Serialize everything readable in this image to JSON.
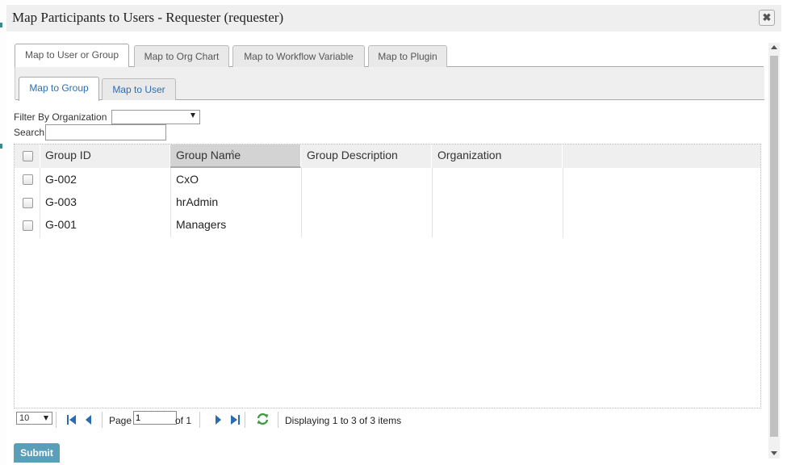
{
  "dialog": {
    "title": "Map Participants to Users - Requester (requester)",
    "close_symbol": "✖"
  },
  "outer_tabs": [
    {
      "label": "Map to User or Group"
    },
    {
      "label": "Map to Org Chart"
    },
    {
      "label": "Map to Workflow Variable"
    },
    {
      "label": "Map to Plugin"
    }
  ],
  "inner_tabs": [
    {
      "label": "Map to Group"
    },
    {
      "label": "Map to User"
    }
  ],
  "filters": {
    "organization_label": "Filter By Organization",
    "organization_value": "",
    "search_label": "Search",
    "search_value": ""
  },
  "grid": {
    "columns": [
      "Group ID",
      "Group Name",
      "Group Description",
      "Organization"
    ],
    "sorted_column": "Group Name",
    "rows": [
      {
        "id": "G-002",
        "name": "CxO",
        "description": "",
        "organization": ""
      },
      {
        "id": "G-003",
        "name": "hrAdmin",
        "description": "",
        "organization": ""
      },
      {
        "id": "G-001",
        "name": "Managers",
        "description": "",
        "organization": ""
      }
    ]
  },
  "pager": {
    "page_size": "10",
    "page_label": "Page",
    "page_value": "1",
    "of_label": "of 1",
    "display_text": "Displaying 1 to 3 of 3 items"
  },
  "submit_label": "Submit",
  "colors": {
    "accent": "#5a9fba",
    "link": "#2a6fb0",
    "refresh": "#3d9a3d",
    "nav": "#2b6cb0"
  }
}
